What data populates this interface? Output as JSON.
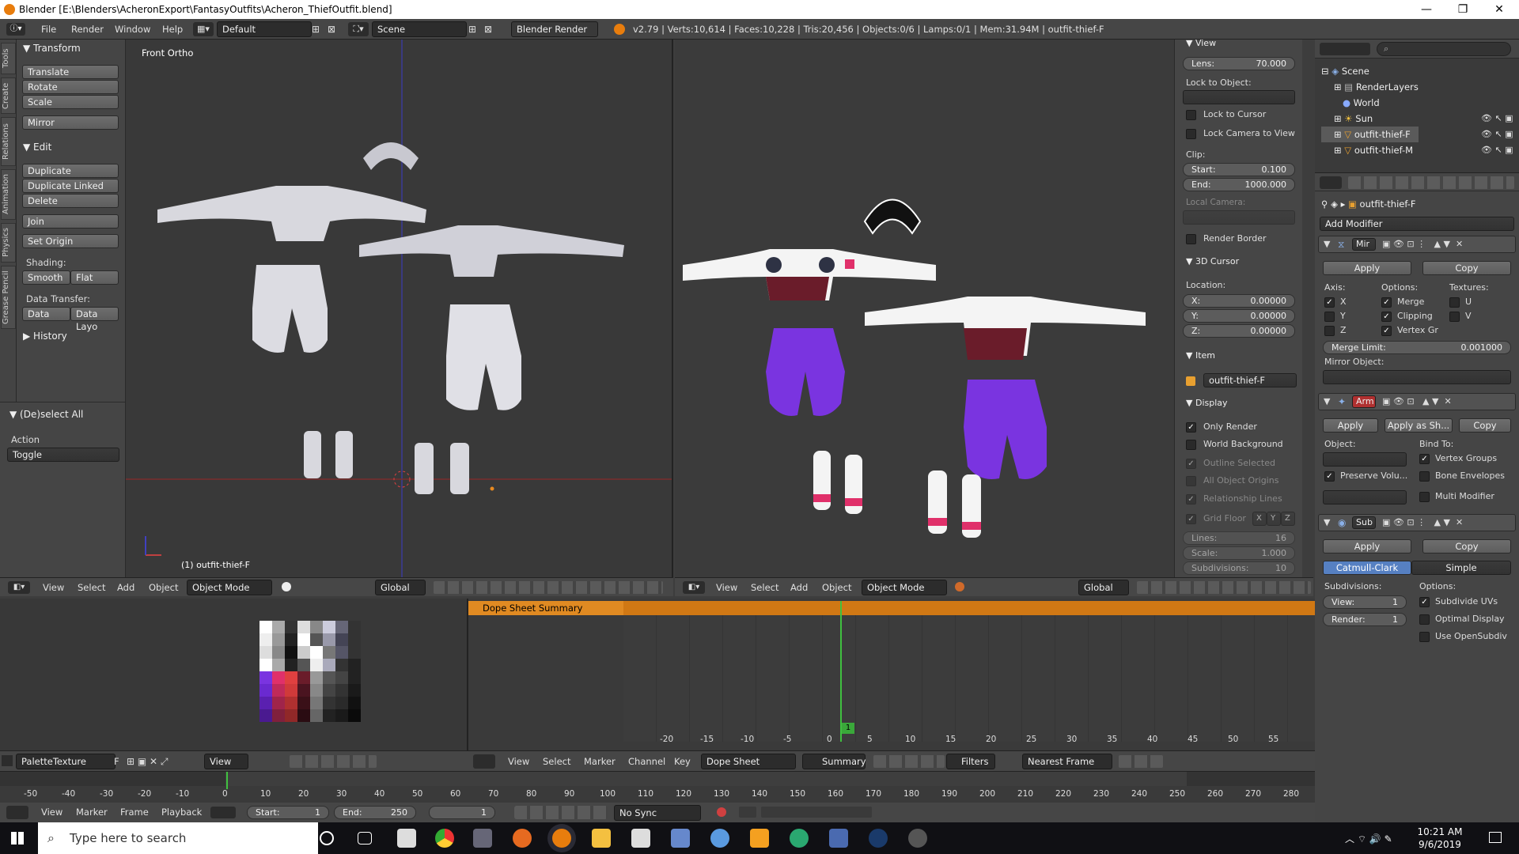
{
  "window": {
    "title": "Blender [E:\\Blenders\\AcheronExport\\FantasyOutfits\\Acheron_ThiefOutfit.blend]",
    "minimize": "—",
    "restore": "❐",
    "close": "✕"
  },
  "infobar": {
    "menus": [
      "File",
      "Render",
      "Window",
      "Help"
    ],
    "layout": "Default",
    "scene": "Scene",
    "engine": "Blender Render",
    "stats": "v2.79 | Verts:10,614 | Faces:10,228 | Tris:20,456 | Objects:0/6 | Lamps:0/1 | Mem:31.94M | outfit-thief-F"
  },
  "toolstrip": {
    "tabs": [
      "Tools",
      "Create",
      "Relations",
      "Animation",
      "Physics",
      "Grease Pencil"
    ]
  },
  "toolshelf": {
    "transform_header": "Transform",
    "translate": "Translate",
    "rotate": "Rotate",
    "scale": "Scale",
    "mirror": "Mirror",
    "edit_header": "Edit",
    "duplicate": "Duplicate",
    "duplicate_linked": "Duplicate Linked",
    "delete": "Delete",
    "join": "Join",
    "set_origin": "Set Origin",
    "shading_label": "Shading:",
    "smooth": "Smooth",
    "flat": "Flat",
    "data_transfer_label": "Data Transfer:",
    "data": "Data",
    "data_layo": "Data Layo",
    "history_header": "History",
    "deselect_header": "(De)select All",
    "action_label": "Action",
    "toggle": "Toggle"
  },
  "viewport1": {
    "label": "Front Ortho",
    "object_label": "(1) outfit-thief-F"
  },
  "npanel": {
    "view_header": "View",
    "lens_label": "Lens:",
    "lens_value": "70.000",
    "lock_to_object": "Lock to Object:",
    "lock_to_cursor": "Lock to Cursor",
    "lock_camera": "Lock Camera to View",
    "clip_label": "Clip:",
    "start_label": "Start:",
    "start_value": "0.100",
    "end_label": "End:",
    "end_value": "1000.000",
    "local_camera": "Local Camera:",
    "render_border": "Render Border",
    "cursor_header": "3D Cursor",
    "location_label": "Location:",
    "x_label": "X:",
    "x_value": "0.00000",
    "y_label": "Y:",
    "y_value": "0.00000",
    "z_label": "Z:",
    "z_value": "0.00000",
    "item_header": "Item",
    "item_name": "outfit-thief-F",
    "display_header": "Display",
    "only_render": "Only Render",
    "world_background": "World Background",
    "outline_selected": "Outline Selected",
    "all_object_origins": "All Object Origins",
    "relationship_lines": "Relationship Lines",
    "grid_floor": "Grid Floor",
    "grid_x": "X",
    "grid_y": "Y",
    "grid_z": "Z",
    "lines_label": "Lines:",
    "lines_value": "16",
    "scale_label": "Scale:",
    "scale_value": "1.000",
    "subdivisions_label": "Subdivisions:",
    "subdivisions_value": "10"
  },
  "vheader": {
    "view": "View",
    "select": "Select",
    "add": "Add",
    "object": "Object",
    "mode": "Object Mode",
    "orientation": "Global"
  },
  "outliner": {
    "items": [
      {
        "label": "Scene",
        "icon": "scene-icon"
      },
      {
        "label": "RenderLayers",
        "icon": "renderlayers-icon"
      },
      {
        "label": "World",
        "icon": "world-icon"
      },
      {
        "label": "Sun",
        "icon": "sun-lamp-icon"
      },
      {
        "label": "outfit-thief-F",
        "icon": "mesh-icon"
      },
      {
        "label": "outfit-thief-M",
        "icon": "mesh-icon"
      }
    ]
  },
  "properties": {
    "object_name": "outfit-thief-F",
    "add_modifier": "Add Modifier",
    "mirror_mod": {
      "name": "Mir",
      "apply": "Apply",
      "copy": "Copy",
      "axis_label": "Axis:",
      "options_label": "Options:",
      "textures_label": "Textures:",
      "x": "X",
      "y": "Y",
      "z": "Z",
      "merge": "Merge",
      "clipping": "Clipping",
      "vertex_gr": "Vertex Gr",
      "u": "U",
      "v": "V",
      "merge_limit_label": "Merge Limit:",
      "merge_limit_value": "0.001000",
      "mirror_object_label": "Mirror Object:"
    },
    "armature_mod": {
      "name": "Arm",
      "apply": "Apply",
      "apply_as_shape": "Apply as Sh...",
      "copy": "Copy",
      "object_label": "Object:",
      "bind_to_label": "Bind To:",
      "vertex_groups": "Vertex Groups",
      "preserve_volume": "Preserve Volu...",
      "bone_envelopes": "Bone Envelopes",
      "multi_modifier": "Multi Modifier"
    },
    "subsurf_mod": {
      "name": "Sub",
      "apply": "Apply",
      "copy": "Copy",
      "catmull_clark": "Catmull-Clark",
      "simple": "Simple",
      "subdivisions_label": "Subdivisions:",
      "options_label": "Options:",
      "view_label": "View:",
      "view_value": "1",
      "render_label": "Render:",
      "render_value": "1",
      "subdivide_uvs": "Subdivide UVs",
      "optimal_display": "Optimal Display",
      "use_opensubdiv": "Use OpenSubdiv"
    }
  },
  "dopesheet": {
    "summary_label": "Dope Sheet Summary",
    "ticks": [
      "-20",
      "-15",
      "-10",
      "-5",
      "0",
      "5",
      "10",
      "15",
      "20",
      "25",
      "30",
      "35",
      "40",
      "45",
      "50",
      "55"
    ],
    "current_frame": "1",
    "header": {
      "view": "View",
      "select": "Select",
      "marker": "Marker",
      "channel": "Channel",
      "key": "Key",
      "mode": "Dope Sheet",
      "summary": "Summary",
      "filters": "Filters",
      "snap": "Nearest Frame"
    }
  },
  "image_editor": {
    "image_name": "PaletteTexture",
    "f_label": "F",
    "view": "View"
  },
  "timeline": {
    "ticks": [
      "-50",
      "-40",
      "-30",
      "-20",
      "-10",
      "0",
      "10",
      "20",
      "30",
      "40",
      "50",
      "60",
      "70",
      "80",
      "90",
      "100",
      "110",
      "120",
      "130",
      "140",
      "150",
      "160",
      "170",
      "180",
      "190",
      "200",
      "210",
      "220",
      "230",
      "240",
      "250",
      "260",
      "270",
      "280"
    ],
    "header": {
      "view": "View",
      "marker": "Marker",
      "frame": "Frame",
      "playback": "Playback",
      "start_label": "Start:",
      "start_value": "1",
      "end_label": "End:",
      "end_value": "250",
      "current": "1",
      "sync": "No Sync"
    }
  },
  "taskbar": {
    "search_placeholder": "Type here to search",
    "time": "10:21 AM",
    "date": "9/6/2019"
  }
}
